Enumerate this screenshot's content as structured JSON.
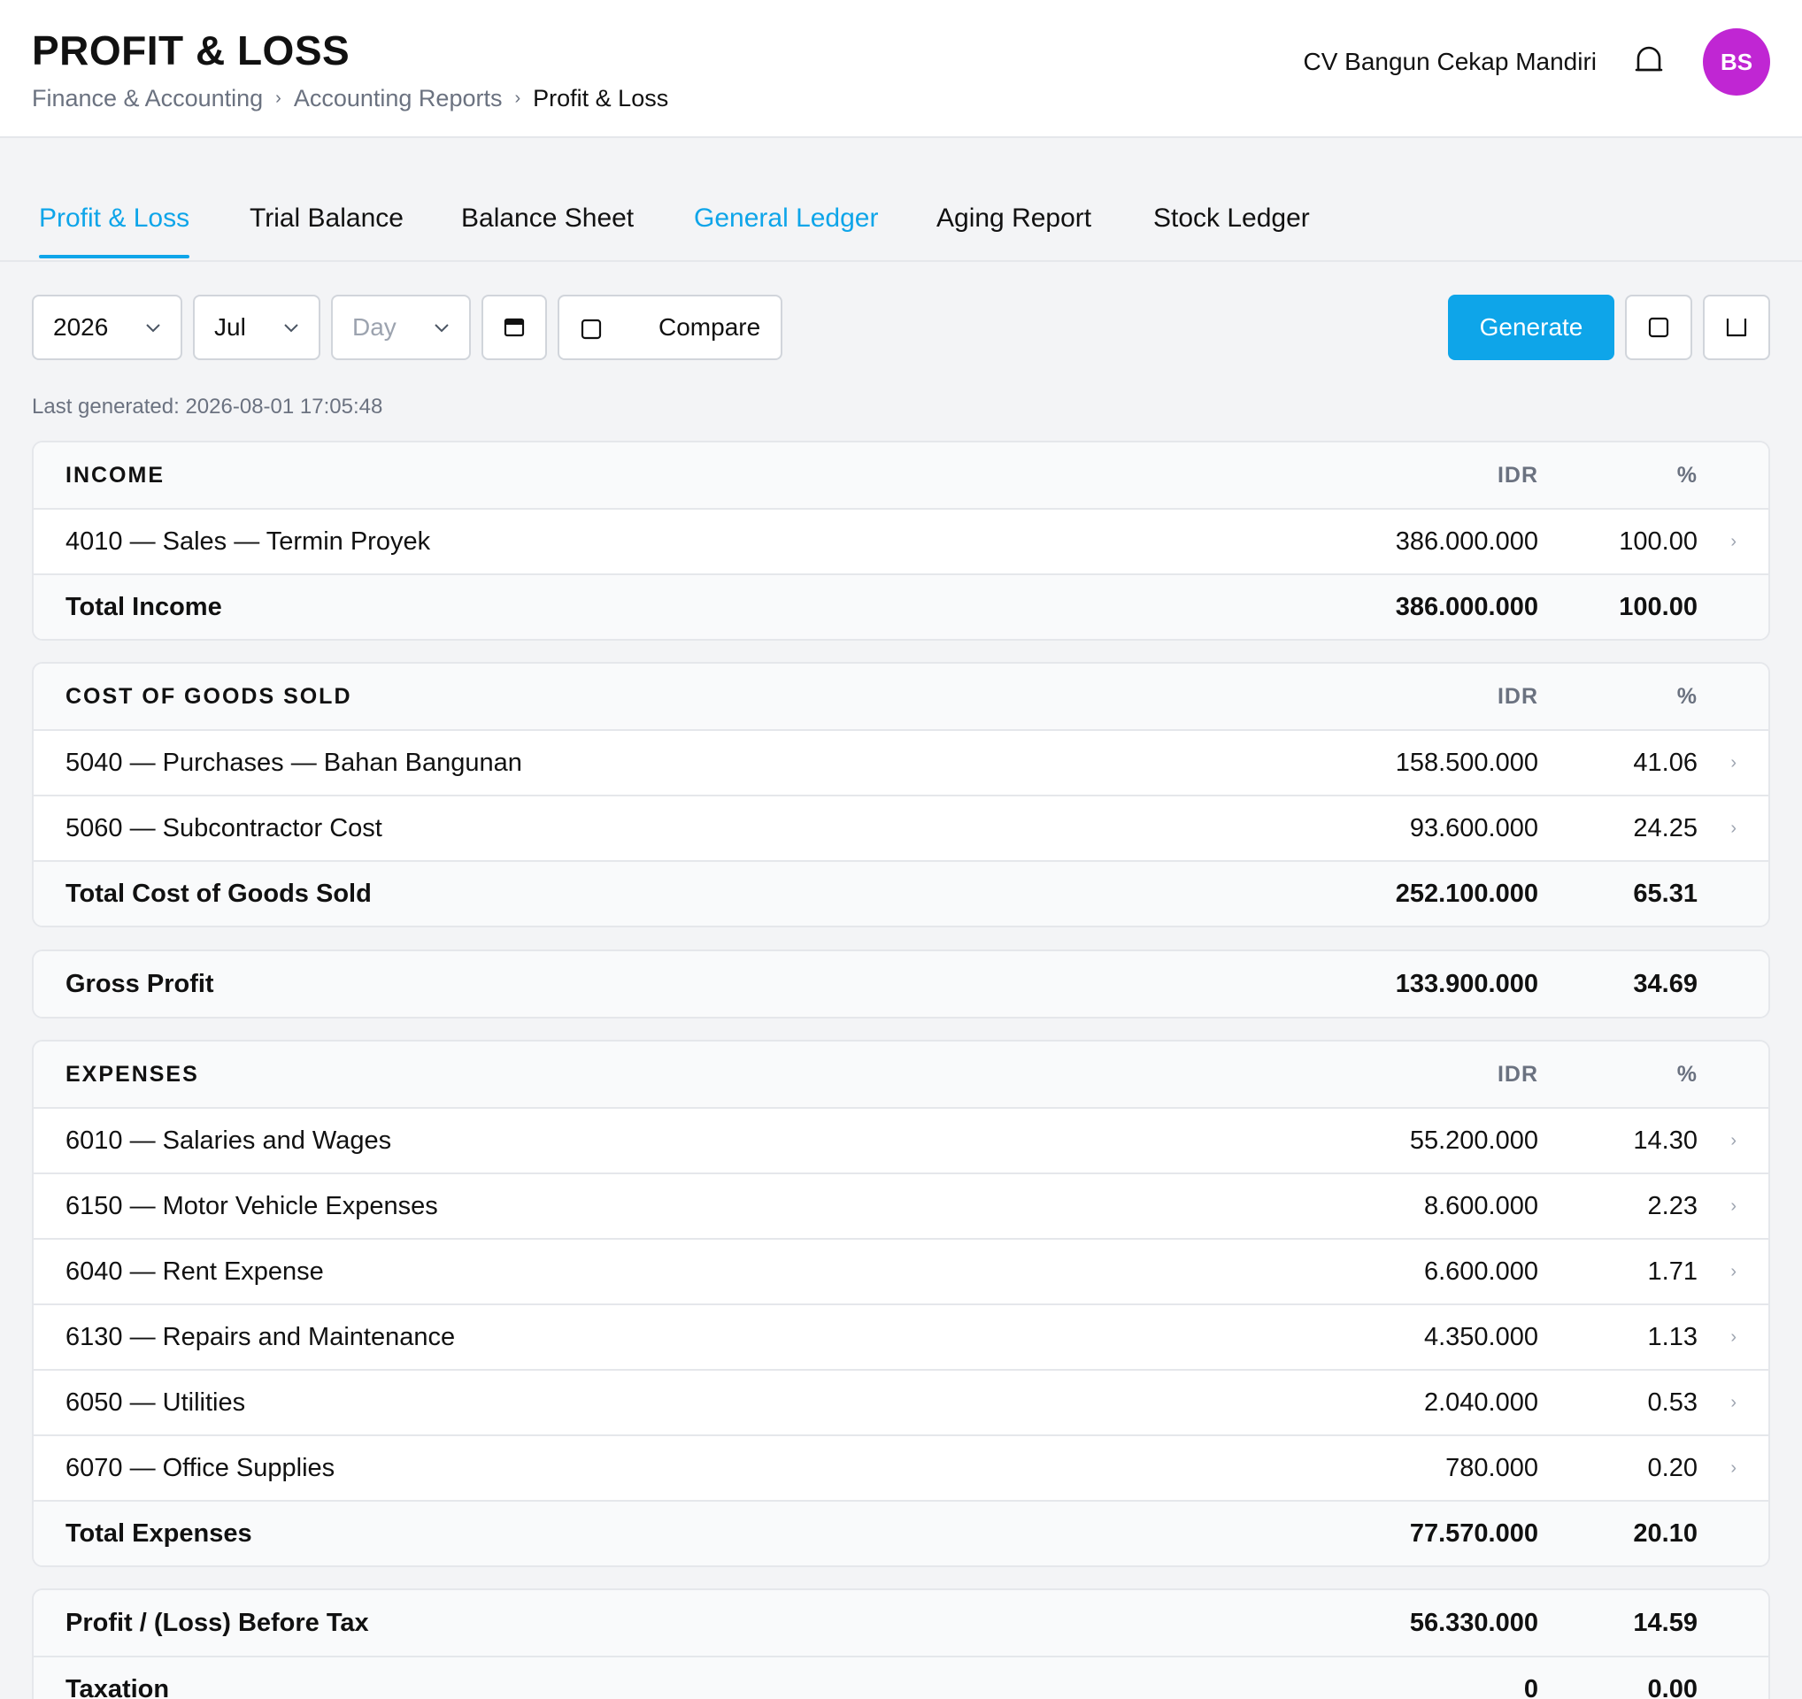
{
  "header": {
    "title": "PROFIT & LOSS",
    "breadcrumb": [
      "Finance & Accounting",
      "Accounting Reports",
      "Profit & Loss"
    ],
    "company": "CV Bangun Cekap Mandiri",
    "avatar_initials": "BS",
    "avatar_color": "#c026d3"
  },
  "tabs": [
    "Profit & Loss",
    "Trial Balance",
    "Balance Sheet",
    "General Ledger",
    "Aging Report",
    "Stock Ledger"
  ],
  "toolbar": {
    "year": "2026",
    "month": "Jul",
    "day_placeholder": "Day",
    "compare_label": "Compare",
    "generate_label": "Generate",
    "accent": "#0ea5e9"
  },
  "last_generated": "Last generated: 2026-08-01 17:05:48",
  "columns": {
    "amount": "IDR",
    "percent": "%"
  },
  "income": {
    "heading": "INCOME",
    "rows": [
      {
        "label": "4010 — Sales — Termin Proyek",
        "amount": "386.000.000",
        "pct": "100.00"
      }
    ],
    "total": {
      "label": "Total Income",
      "amount": "386.000.000",
      "pct": "100.00"
    }
  },
  "cogs": {
    "heading": "COST OF GOODS SOLD",
    "rows": [
      {
        "label": "5040 — Purchases — Bahan Bangunan",
        "amount": "158.500.000",
        "pct": "41.06"
      },
      {
        "label": "5060 — Subcontractor Cost",
        "amount": "93.600.000",
        "pct": "24.25"
      }
    ],
    "total": {
      "label": "Total Cost of Goods Sold",
      "amount": "252.100.000",
      "pct": "65.31"
    }
  },
  "gross_profit": {
    "label": "Gross Profit",
    "amount": "133.900.000",
    "pct": "34.69"
  },
  "expenses": {
    "heading": "EXPENSES",
    "rows": [
      {
        "label": "6010 — Salaries and Wages",
        "amount": "55.200.000",
        "pct": "14.30"
      },
      {
        "label": "6150 — Motor Vehicle Expenses",
        "amount": "8.600.000",
        "pct": "2.23"
      },
      {
        "label": "6040 — Rent Expense",
        "amount": "6.600.000",
        "pct": "1.71"
      },
      {
        "label": "6130 — Repairs and Maintenance",
        "amount": "4.350.000",
        "pct": "1.13"
      },
      {
        "label": "6050 — Utilities",
        "amount": "2.040.000",
        "pct": "0.53"
      },
      {
        "label": "6070 — Office Supplies",
        "amount": "780.000",
        "pct": "0.20"
      }
    ],
    "total": {
      "label": "Total Expenses",
      "amount": "77.570.000",
      "pct": "20.10"
    }
  },
  "before_tax": {
    "label": "Profit / (Loss) Before Tax",
    "amount": "56.330.000",
    "pct": "14.59"
  },
  "taxation": {
    "label": "Taxation",
    "amount": "0",
    "pct": "0.00"
  }
}
